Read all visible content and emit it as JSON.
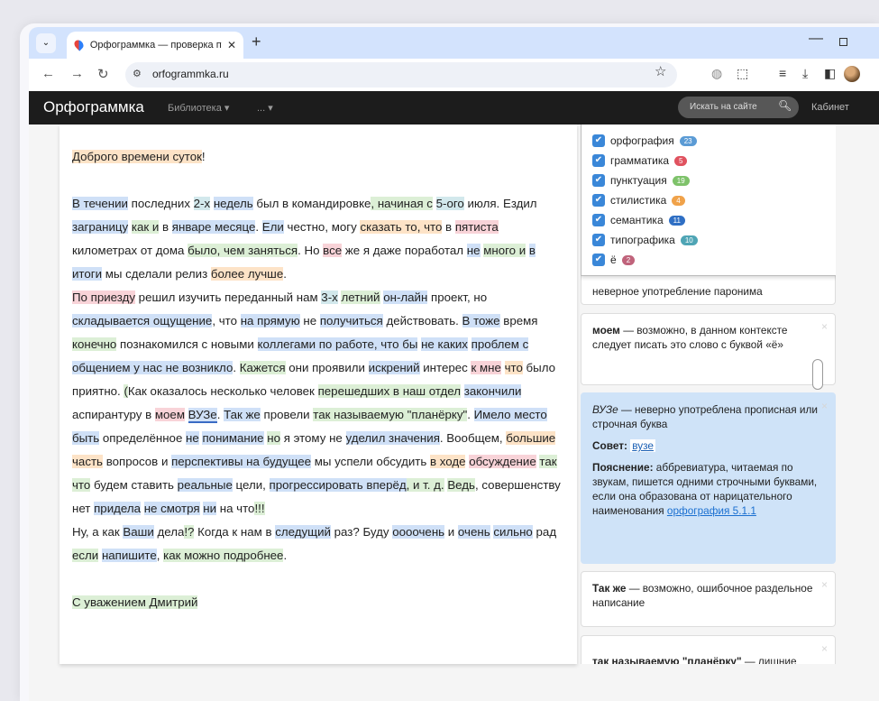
{
  "browser": {
    "tab_title": "Орфограммка — проверка пу",
    "url": "orfogrammka.ru"
  },
  "site": {
    "logo": "Орфограммка",
    "menu_library": "Библиотека ▾",
    "menu_more": "... ▾",
    "search_placeholder": "Искать на сайте",
    "cabinet": "Кабинет"
  },
  "filters": [
    {
      "label": "орфография",
      "count": "23",
      "color": "#5b9bd5"
    },
    {
      "label": "грамматика",
      "count": "5",
      "color": "#e0525f"
    },
    {
      "label": "пунктуация",
      "count": "19",
      "color": "#7ec26a"
    },
    {
      "label": "стилистика",
      "count": "4",
      "color": "#f0a24a"
    },
    {
      "label": "семантика",
      "count": "11",
      "color": "#2f6fc4"
    },
    {
      "label": "типографика",
      "count": "10",
      "color": "#4fa5b5"
    },
    {
      "label": "ё",
      "count": "2",
      "color": "#c0637b"
    }
  ],
  "cards": {
    "c1_text": "неверное употребление паронима",
    "c2_word": "моем",
    "c2_text": " — возможно, в данном контексте следует писать это слово с буквой «ё»",
    "c3_word": "ВУЗе",
    "c3_text": " — неверно употреблена прописная или строчная буква",
    "c3_advice_label": "Совет:",
    "c3_advice": "вузе",
    "c3_expl_label": "Пояснение:",
    "c3_expl": " аббревиатура, читаемая по звукам, пишется одними строчными буквами, если она образована от нарицательного наименования ",
    "c3_link": "орфография 5.1.1",
    "c4_word": "Так же",
    "c4_text": " — возможно, ошибочное раздельное написание",
    "c5_word": "так называемую \"планёрку\"",
    "c5_text": " — лишние",
    "close": "×"
  },
  "text": {
    "greeting": "Доброго времени суток",
    "greeting_tail": "!",
    "signature": "С уважением Дмитрий"
  }
}
